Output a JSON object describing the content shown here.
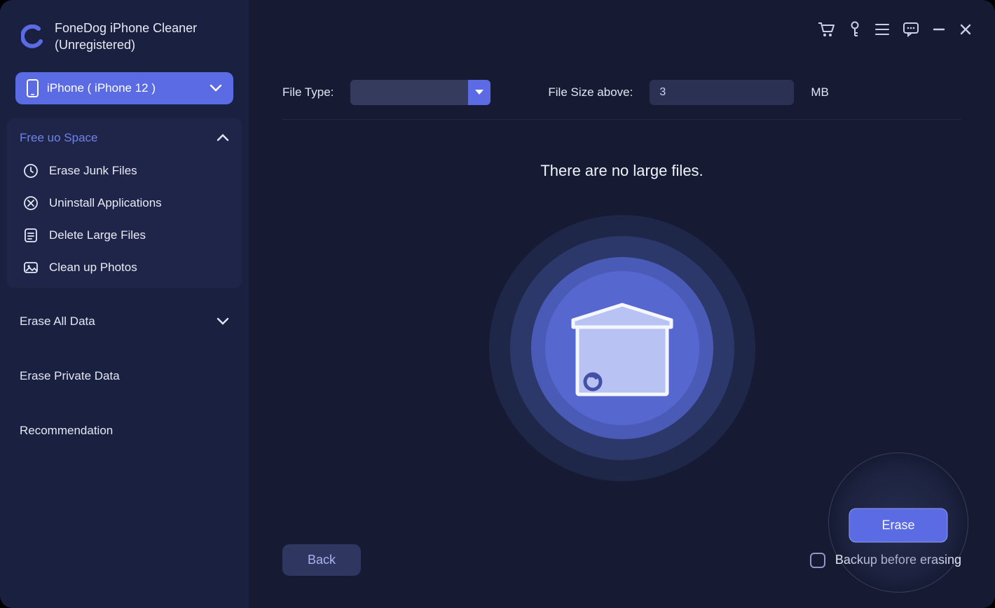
{
  "brand": {
    "line1": "FoneDog iPhone  Cleaner",
    "line2": "(Unregistered)"
  },
  "device": {
    "label": "iPhone ( iPhone 12 )"
  },
  "sections": {
    "freeSpace": {
      "title": "Free uo Space",
      "items": [
        "Erase Junk Files",
        "Uninstall Applications",
        "Delete Large Files",
        "Clean up Photos"
      ]
    },
    "eraseAll": {
      "title": "Erase All Data"
    },
    "erasePrivate": {
      "title": "Erase Private Data"
    },
    "recommendation": {
      "title": "Recommendation"
    }
  },
  "filters": {
    "fileTypeLabel": "File Type:",
    "fileSizeLabel": "File Size above:",
    "fileSizeValue": "3",
    "unit": "MB"
  },
  "main": {
    "message": "There are no large files."
  },
  "footer": {
    "backLabel": "Back",
    "backupLabel": "Backup before erasing",
    "eraseLabel": "Erase"
  }
}
